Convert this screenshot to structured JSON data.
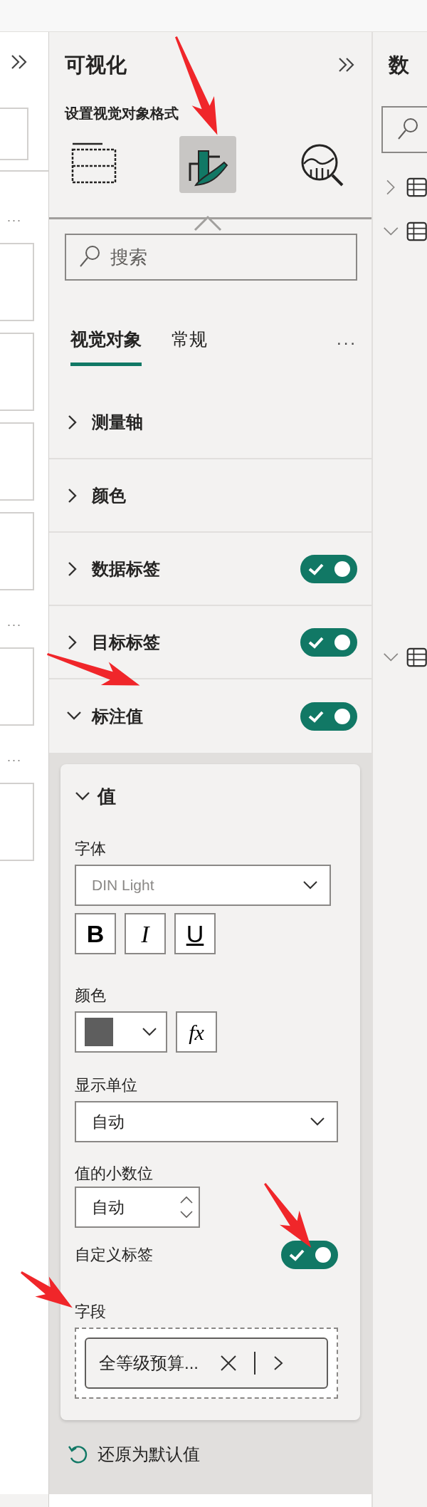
{
  "left_pane": {
    "more_labels": [
      "...",
      "...",
      "..."
    ]
  },
  "visualizations": {
    "title": "可视化",
    "subtitle": "设置视觉对象格式",
    "view_buttons": [
      {
        "kind": "build",
        "selected": false
      },
      {
        "kind": "format",
        "selected": true
      },
      {
        "kind": "analytics",
        "selected": false
      }
    ],
    "search": {
      "placeholder": "搜索"
    },
    "tabs": [
      {
        "label": "视觉对象",
        "selected": true
      },
      {
        "label": "常规",
        "selected": false
      }
    ],
    "more_label": "...",
    "sections": [
      {
        "label": "测量轴",
        "expanded": false
      },
      {
        "label": "颜色",
        "expanded": false
      },
      {
        "label": "数据标签",
        "expanded": false,
        "on": true
      },
      {
        "label": "目标标签",
        "expanded": false,
        "on": true
      },
      {
        "label": "标注值",
        "expanded": true,
        "on": true
      }
    ],
    "card": {
      "title": "值",
      "expanded": true,
      "font_label": "字体",
      "font": "DIN Light",
      "style_buttons": [
        {
          "kind": "bold",
          "label": "B"
        },
        {
          "kind": "italic",
          "label": "I"
        },
        {
          "kind": "underline",
          "label": "U"
        }
      ],
      "color_label": "颜色",
      "fx_label": "fx",
      "unit_label": "显示单位",
      "unit": "自动",
      "decimals_label": "值的小数位",
      "decimals": "自动",
      "custom_label": {
        "label": "自定义标签",
        "on": true
      },
      "field_label": "字段",
      "field": "全等级预算..."
    },
    "reset": "还原为默认值"
  },
  "data_pane": {
    "title": "数",
    "tree": [
      {
        "expanded": false
      },
      {
        "expanded": true
      },
      {
        "expanded": true
      }
    ]
  },
  "annotations": [
    {
      "kind": "arrow"
    },
    {
      "kind": "arrow"
    },
    {
      "kind": "arrow"
    },
    {
      "kind": "arrow"
    }
  ]
}
